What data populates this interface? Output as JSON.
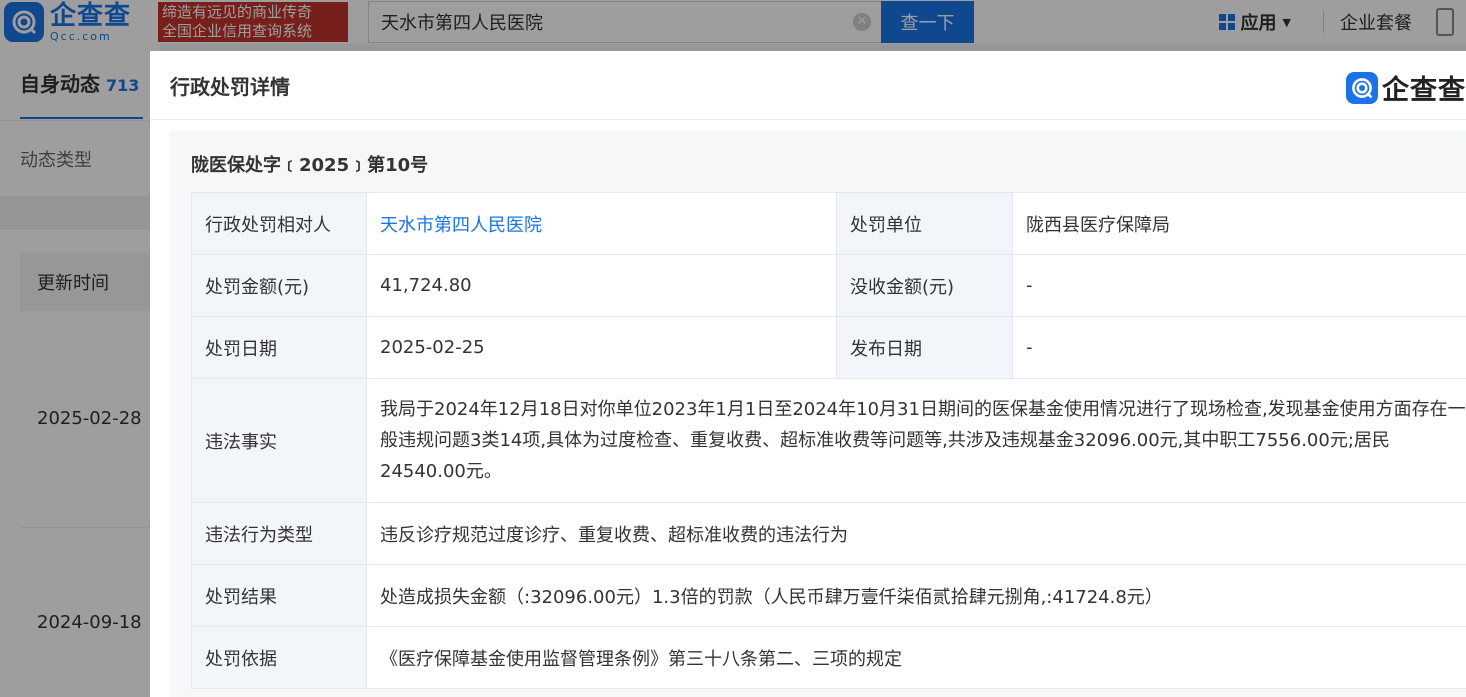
{
  "topbar": {
    "logo_cn": "企查查",
    "logo_en": "Qcc.com",
    "slogan_line1": "缔造有远见的商业传奇",
    "slogan_line2": "全国企业信用查询系统",
    "search_value": "天水市第四人民医院",
    "search_button": "查一下",
    "apps_label": "应用",
    "package_label": "企业套餐"
  },
  "background": {
    "tab_label": "自身动态",
    "tab_count": "713",
    "type_label": "动态类型",
    "table_header": "更新时间",
    "dates": [
      "2025-02-28",
      "2024-09-18"
    ]
  },
  "modal": {
    "title": "行政处罚详情",
    "logo_text": "企查查",
    "doc_number": "陇医保处字﹝2025﹞第10号",
    "rows": {
      "party_label": "行政处罚相对人",
      "party_value": "天水市第四人民医院",
      "authority_label": "处罚单位",
      "authority_value": "陇西县医疗保障局",
      "amount_label": "处罚金额(元)",
      "amount_value": "41,724.80",
      "confiscated_label": "没收金额(元)",
      "confiscated_value": "-",
      "date_label": "处罚日期",
      "date_value": "2025-02-25",
      "publish_label": "发布日期",
      "publish_value": "-",
      "facts_label": "违法事实",
      "facts_value": "我局于2024年12月18日对你单位2023年1月1日至2024年10月31日期间的医保基金使用情况进行了现场检查,发现基金使用方面存在一般违规问题3类14项,具体为过度检查、重复收费、超标准收费等问题等,共涉及违规基金32096.00元,其中职工7556.00元;居民24540.00元。",
      "type_label": "违法行为类型",
      "type_value": "违反诊疗规范过度诊疗、重复收费、超标准收费的违法行为",
      "result_label": "处罚结果",
      "result_value": "处造成损失金额（:32096.00元）1.3倍的罚款（人民币肆万壹仟柒佰贰拾肆元捌角,:41724.8元）",
      "basis_label": "处罚依据",
      "basis_value": "《医疗保障基金使用监督管理条例》第三十八条第二、三项的规定"
    }
  },
  "colors": {
    "brand_blue": "#1a74e8",
    "slogan_red": "#c0322a",
    "label_bg": "#f2f5fa"
  }
}
